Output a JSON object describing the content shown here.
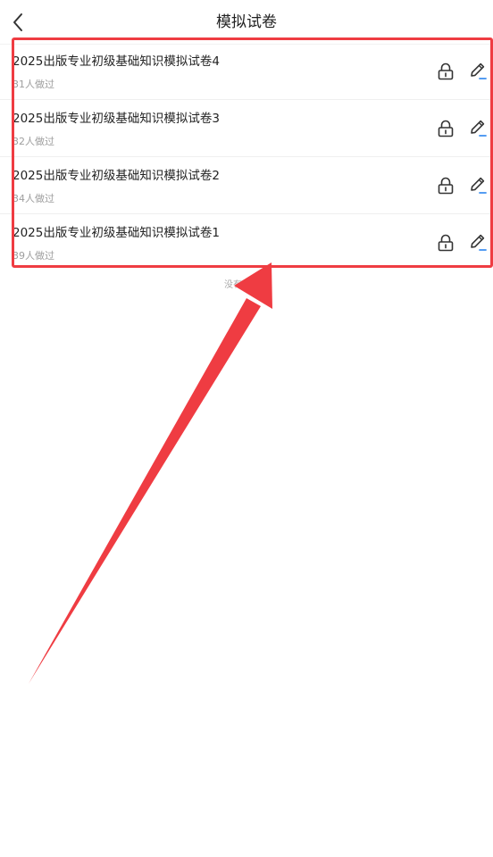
{
  "header": {
    "title": "模拟试卷",
    "back_icon": "chevron-left-icon"
  },
  "papers": [
    {
      "title": "2025出版专业初级基础知识模拟试卷4",
      "meta": "31人做过"
    },
    {
      "title": "2025出版专业初级基础知识模拟试卷3",
      "meta": "32人做过"
    },
    {
      "title": "2025出版专业初级基础知识模拟试卷2",
      "meta": "34人做过"
    },
    {
      "title": "2025出版专业初级基础知识模拟试卷1",
      "meta": "39人做过"
    }
  ],
  "footer": {
    "no_more": "没有更多了"
  },
  "colors": {
    "annotation": "#ef3c42",
    "accent": "#3d8ff0",
    "text": "#222222",
    "muted": "#9e9e9e"
  }
}
